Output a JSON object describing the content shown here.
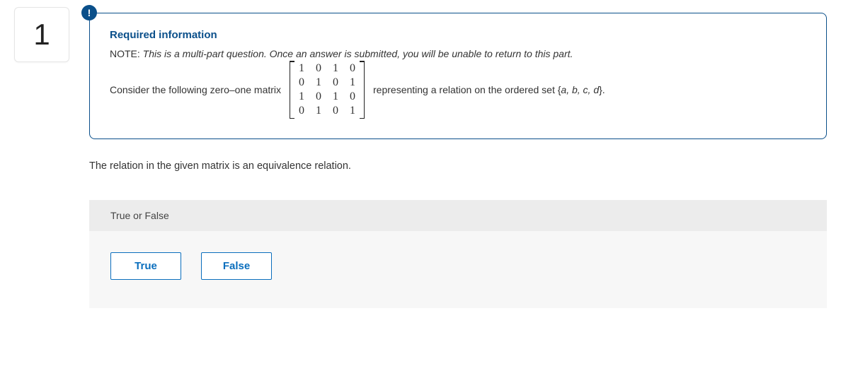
{
  "question": {
    "number": "1",
    "alert_symbol": "!",
    "required_heading": "Required information",
    "note_label": "NOTE:",
    "note_text": "This is a multi-part question. Once an answer is submitted, you will be unable to return to this part.",
    "pre_matrix_text": "Consider the following zero–one matrix",
    "post_matrix_text_1": "representing a relation on the ordered set {",
    "post_matrix_set": "a, b, c, d",
    "post_matrix_text_2": "}.",
    "matrix": [
      [
        "1",
        "0",
        "1",
        "0"
      ],
      [
        "0",
        "1",
        "0",
        "1"
      ],
      [
        "1",
        "0",
        "1",
        "0"
      ],
      [
        "0",
        "1",
        "0",
        "1"
      ]
    ],
    "statement": "The relation in the given matrix is an equivalence relation."
  },
  "answer": {
    "header": "True or False",
    "options": {
      "true_label": "True",
      "false_label": "False"
    }
  }
}
